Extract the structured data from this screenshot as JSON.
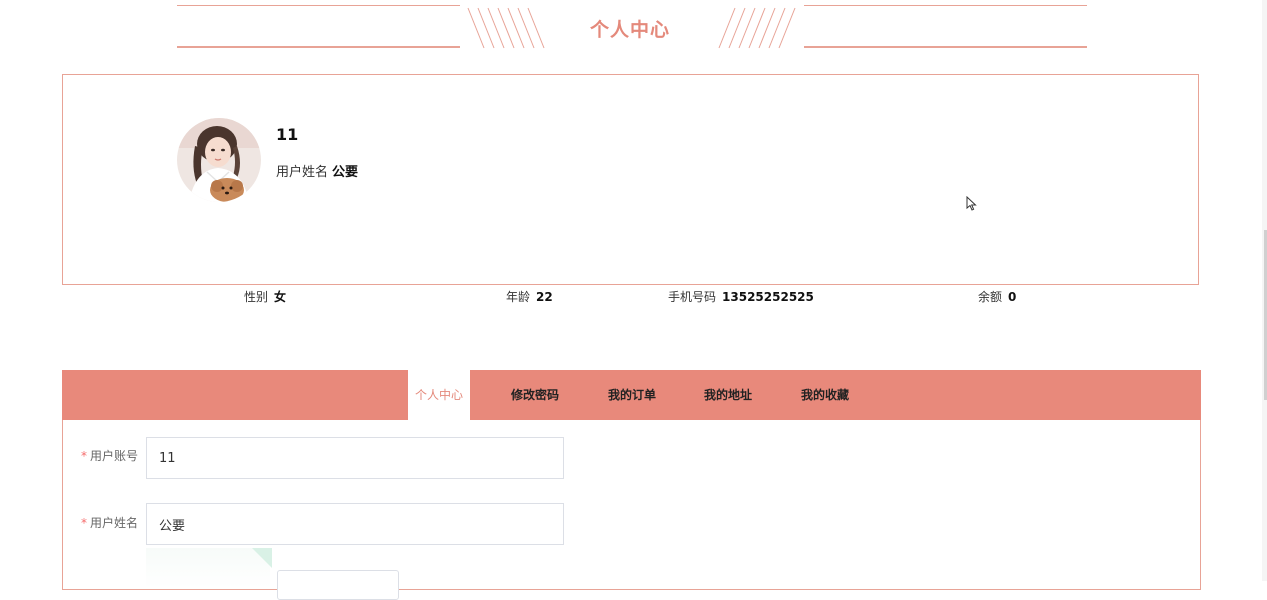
{
  "page_title": "个人中心",
  "profile": {
    "account": "11",
    "name_label": "用户姓名",
    "name_value": "公要"
  },
  "stats": {
    "gender_label": "性别",
    "gender_value": "女",
    "age_label": "年龄",
    "age_value": "22",
    "phone_label": "手机号码",
    "phone_value": "13525252525",
    "balance_label": "余额",
    "balance_value": "0"
  },
  "tabs": [
    {
      "label": "个人中心",
      "active": true
    },
    {
      "label": "修改密码",
      "active": false
    },
    {
      "label": "我的订单",
      "active": false
    },
    {
      "label": "我的地址",
      "active": false
    },
    {
      "label": "我的收藏",
      "active": false
    }
  ],
  "form": {
    "required_mark": "*",
    "account_label": "用户账号",
    "account_value": "11",
    "name_label": "用户姓名",
    "name_value": "公要"
  },
  "colors": {
    "accent": "#e8897b",
    "border": "#e8a396",
    "title": "#e4897b",
    "required": "#f56c6c"
  }
}
